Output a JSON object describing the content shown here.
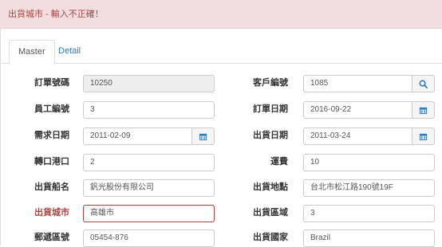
{
  "alert": {
    "message": "出貨城市 - 輸入不正確！"
  },
  "tabs": [
    {
      "label": "Master",
      "active": true
    },
    {
      "label": "Detail",
      "active": false
    }
  ],
  "form": {
    "order_id": {
      "label": "訂單號碼",
      "value": "10250"
    },
    "customer_id": {
      "label": "客戶編號",
      "value": "1085"
    },
    "employee_id": {
      "label": "員工編號",
      "value": "3"
    },
    "order_date": {
      "label": "訂單日期",
      "value": "2016-09-22"
    },
    "required_date": {
      "label": "需求日期",
      "value": "2011-02-09"
    },
    "shipped_date": {
      "label": "出貨日期",
      "value": "2011-03-24"
    },
    "ship_via": {
      "label": "轉口港口",
      "value": "2"
    },
    "freight": {
      "label": "運費",
      "value": "10"
    },
    "ship_name": {
      "label": "出貨船名",
      "value": "釩光股份有限公司"
    },
    "ship_address": {
      "label": "出貨地點",
      "value": "台北市松江路190號19F"
    },
    "ship_city": {
      "label": "出貨城市",
      "value": "高雄市"
    },
    "ship_region": {
      "label": "出貨區域",
      "value": "3"
    },
    "ship_postal_code": {
      "label": "郵遞區號",
      "value": "05454-876"
    },
    "ship_country": {
      "label": "出貨國家",
      "value": "Brazil"
    }
  },
  "colors": {
    "error": "#a94442",
    "alert_bg": "#f2dede",
    "link": "#337ab7",
    "icon": "#337ab7"
  },
  "icons": {
    "search": "search-icon",
    "calendar": "calendar-icon"
  }
}
